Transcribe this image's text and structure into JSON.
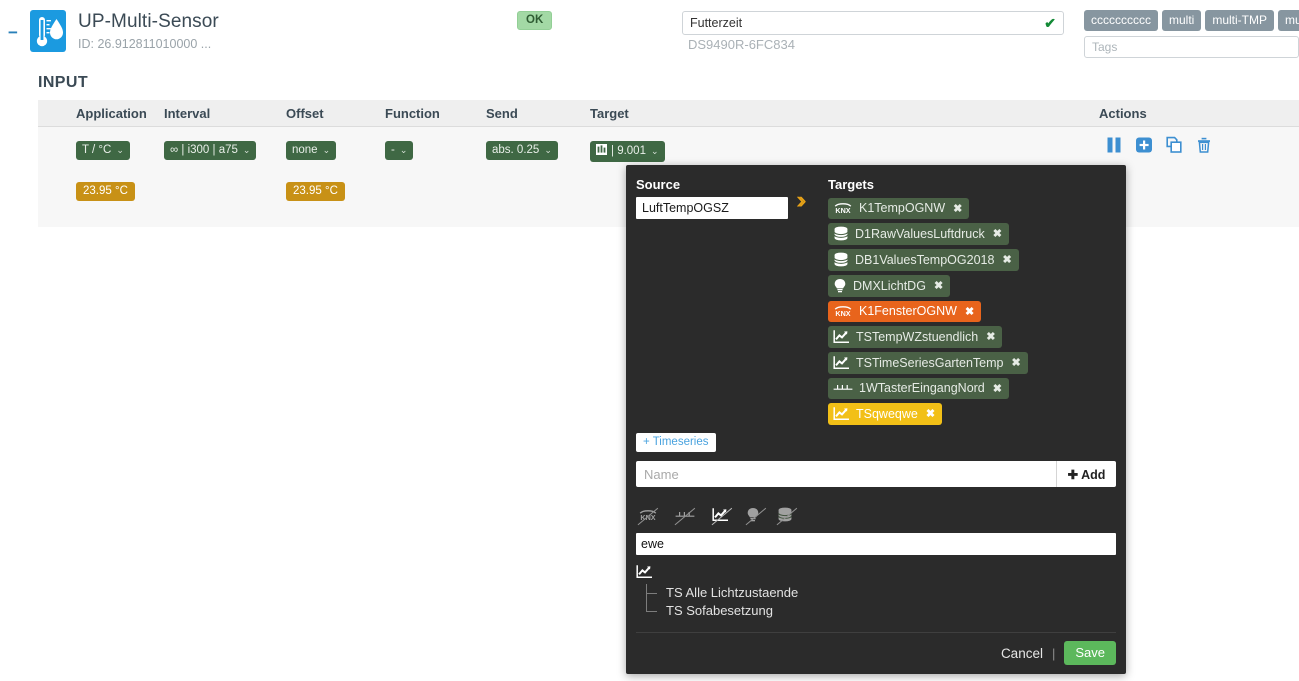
{
  "header": {
    "collapse_glyph": "−",
    "device_icon": "thermometer-humidity-icon",
    "title": "UP-Multi-Sensor",
    "subtitle": "ID: 26.912811010000 ...",
    "status": "OK",
    "status_color": "#a3d9a5",
    "name_value": "Futterzeit",
    "name_valid_glyph": "✔",
    "device_id2": "DS9490R-6FC834",
    "tags": [
      "cccccccccc",
      "multi",
      "multi-TMP",
      "mu"
    ],
    "tags_placeholder": "Tags"
  },
  "section": {
    "title": "INPUT"
  },
  "table": {
    "columns": [
      "Application",
      "Interval",
      "Offset",
      "Function",
      "Send",
      "Target",
      "Actions"
    ],
    "row": {
      "application": "T / °C",
      "application_value": "23.95 °C",
      "interval": "∞ | i300 | a75",
      "offset": "none",
      "offset_value": "23.95 °C",
      "function": "-",
      "send": "abs. 0.25",
      "target": "9.001",
      "target_icon": "knx-bars-icon",
      "caret": "⌄",
      "actions": [
        {
          "name": "pause-button",
          "label": "pause"
        },
        {
          "name": "add-button",
          "label": "add"
        },
        {
          "name": "copy-button",
          "label": "copy"
        },
        {
          "name": "delete-button",
          "label": "delete"
        }
      ]
    }
  },
  "popup": {
    "source_label": "Source",
    "source_value": "LuftTempOGSZ",
    "arrows_glyph": "››",
    "targets_label": "Targets",
    "targets": [
      {
        "label": "K1TempOGNW",
        "icon": "knx-icon",
        "color": "green"
      },
      {
        "label": "D1RawValuesLuftdruck",
        "icon": "database-icon",
        "color": "green"
      },
      {
        "label": "DB1ValuesTempOG2018",
        "icon": "database-icon",
        "color": "green"
      },
      {
        "label": "DMXLichtDG",
        "icon": "lightbulb-icon",
        "color": "green"
      },
      {
        "label": "K1FensterOGNW",
        "icon": "knx-icon",
        "color": "orange"
      },
      {
        "label": "TSTempWZstuendlich",
        "icon": "chart-icon",
        "color": "green"
      },
      {
        "label": "TSTimeSeriesGartenTemp",
        "icon": "chart-icon",
        "color": "green"
      },
      {
        "label": "1WTasterEingangNord",
        "icon": "onewire-icon",
        "color": "green"
      },
      {
        "label": "TSqweqwe",
        "icon": "chart-icon",
        "color": "yellow"
      }
    ],
    "remove_glyph": "✖",
    "timeseries_button": "+ Timeseries",
    "name_placeholder": "Name",
    "name_value": "",
    "add_button": "✚ Add",
    "filters": [
      {
        "name": "knx-filter-icon",
        "active": false
      },
      {
        "name": "onewire-filter-icon",
        "active": false
      },
      {
        "name": "chart-filter-icon",
        "active": true
      },
      {
        "name": "lightbulb-filter-icon",
        "active": false
      },
      {
        "name": "database-filter-icon",
        "active": false
      }
    ],
    "search_value": "ewe",
    "tree_root_icon": "chart-icon",
    "tree_items": [
      "TS Alle Lichtzustaende",
      "TS Sofabesetzung"
    ],
    "cancel_label": "Cancel",
    "separator": "|",
    "save_label": "Save",
    "save_color": "#5cb85c",
    "background": "#2b2b2b"
  }
}
